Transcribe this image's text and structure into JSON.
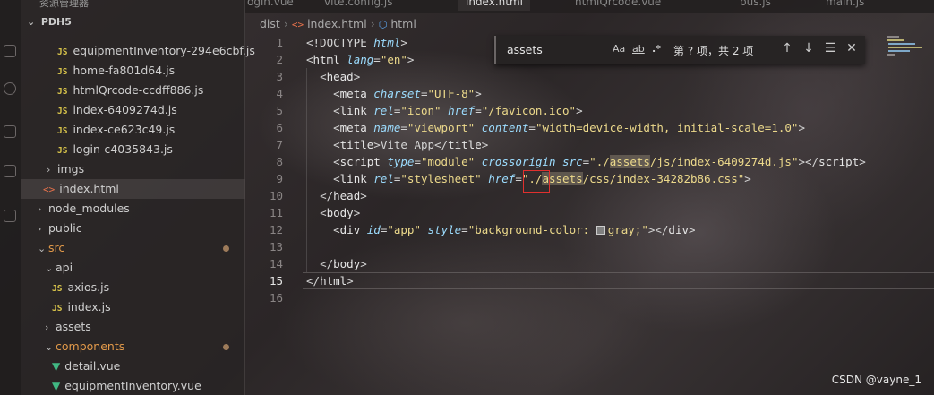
{
  "tabs": [
    "ogin.vue",
    "vite.config.js",
    "index.html",
    "htmlQrcode.vue",
    "bus.js",
    "main.js"
  ],
  "sidebar": {
    "header": "资源管理器",
    "root": "PDH5",
    "items": [
      {
        "label": "equipmentInventory-294e6cbf.js",
        "type": "js"
      },
      {
        "label": "home-fa801d64.js",
        "type": "js"
      },
      {
        "label": "htmlQrcode-ccdff886.js",
        "type": "js"
      },
      {
        "label": "index-6409274d.js",
        "type": "js"
      },
      {
        "label": "index-ce623c49.js",
        "type": "js"
      },
      {
        "label": "login-c4035843.js",
        "type": "js"
      },
      {
        "label": "imgs",
        "type": "folder-closed"
      },
      {
        "label": "index.html",
        "type": "html"
      },
      {
        "label": "node_modules",
        "type": "folder-closed"
      },
      {
        "label": "public",
        "type": "folder-closed"
      },
      {
        "label": "src",
        "type": "folder-open"
      },
      {
        "label": "api",
        "type": "folder-open"
      },
      {
        "label": "axios.js",
        "type": "js"
      },
      {
        "label": "index.js",
        "type": "js"
      },
      {
        "label": "assets",
        "type": "folder-closed"
      },
      {
        "label": "components",
        "type": "folder-open"
      },
      {
        "label": "detail.vue",
        "type": "vue"
      },
      {
        "label": "equipmentInventory.vue",
        "type": "vue"
      }
    ]
  },
  "breadcrumb": [
    "dist",
    "index.html",
    "html"
  ],
  "find": {
    "value": "assets",
    "case_label": "Aa",
    "word_label": "ab",
    "regex_label": ".*",
    "count": "第 ? 项，共 2 项"
  },
  "editor": {
    "current_line": 15,
    "line_numbers": [
      "1",
      "2",
      "3",
      "4",
      "5",
      "6",
      "7",
      "8",
      "9",
      "10",
      "11",
      "12",
      "13",
      "14",
      "15",
      "16"
    ]
  },
  "code": {
    "l1_doctype": "<!DOCTYPE",
    "l1_html": "html",
    "l2_html": "html",
    "l2_lang": "lang",
    "l2_en": "\"en\"",
    "l3": "head",
    "l4_meta": "meta",
    "l4_charset": "charset",
    "l4_val": "\"UTF-8\"",
    "l5_link": "link",
    "l5_rel": "rel",
    "l5_relv": "\"icon\"",
    "l5_href": "href",
    "l5_hrefv": "\"/favicon.ico\"",
    "l6_meta": "meta",
    "l6_name": "name",
    "l6_namev": "\"viewport\"",
    "l6_content": "content",
    "l6_contentv": "\"width=device-width, initial-scale=1.0\"",
    "l7_title": "title",
    "l7_text": "Vite App",
    "l8_script": "script",
    "l8_type": "type",
    "l8_typev": "\"module\"",
    "l8_cross": "crossorigin",
    "l8_src": "src",
    "l8_q": "\"",
    "l8_pre": "./",
    "l8_assets": "assets",
    "l8_rest": "/js/index-6409274d.js\"",
    "l9_link": "link",
    "l9_rel": "rel",
    "l9_relv": "\"stylesheet\"",
    "l9_href": "href",
    "l9_q": "\"",
    "l9_pre": "./",
    "l9_assets": "assets",
    "l9_rest": "/css/index-34282b86.css\"",
    "l10": "head",
    "l11": "body",
    "l12_div": "div",
    "l12_id": "id",
    "l12_idv": "\"app\"",
    "l12_style": "style",
    "l12_stylev1": "\"background-color: ",
    "l12_stylev2": "gray;\"",
    "l14": "body",
    "l15": "html"
  },
  "watermark": "CSDN @vayne_1",
  "colors": {
    "swatch": "#808080",
    "highlight_box": "#e0302e"
  }
}
